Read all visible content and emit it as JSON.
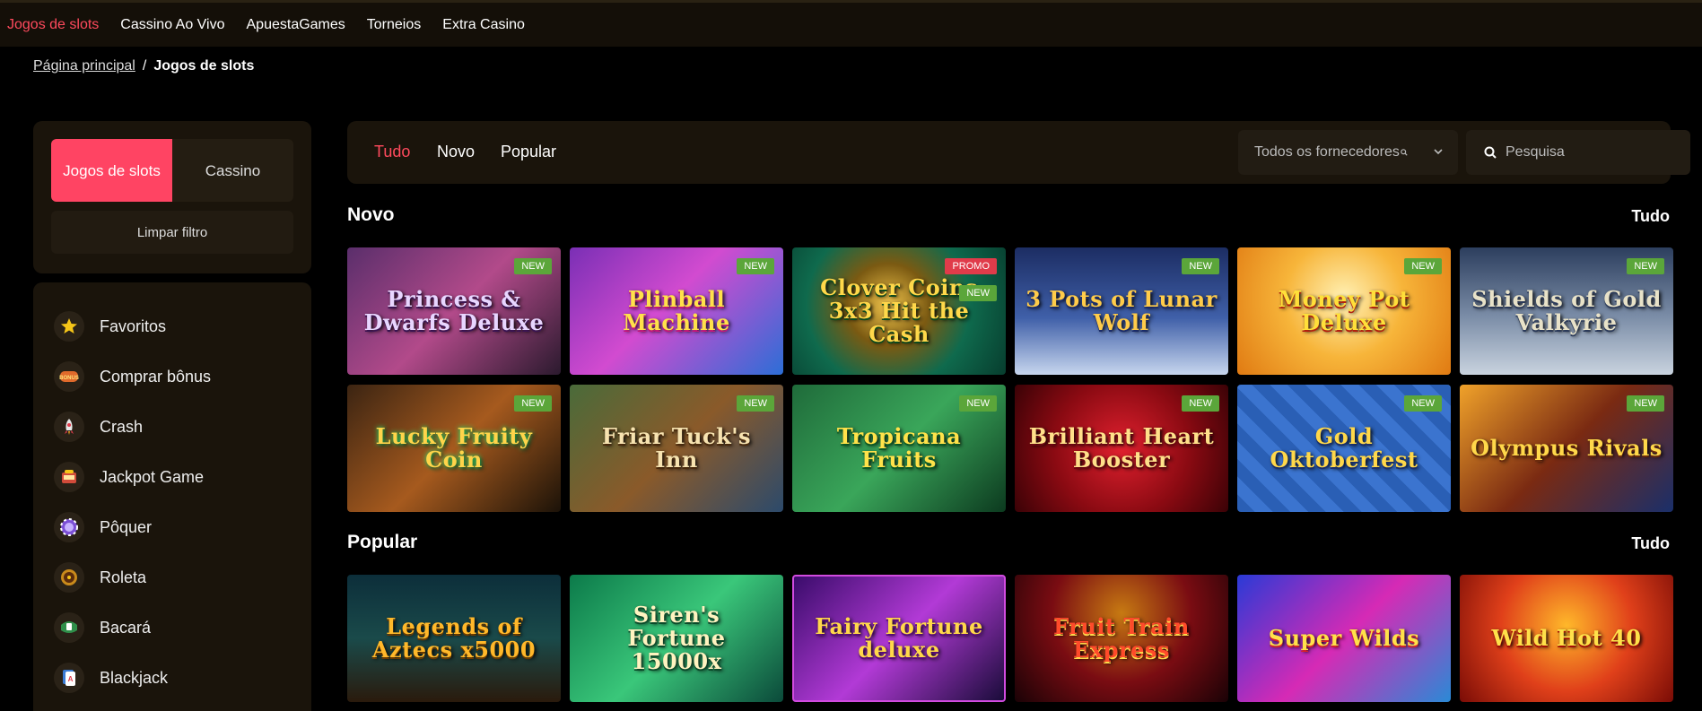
{
  "topnav": {
    "items": [
      "Jogos de slots",
      "Cassino Ao Vivo",
      "ApuestaGames",
      "Torneios",
      "Extra Casino"
    ]
  },
  "breadcrumb": {
    "home": "Página principal",
    "current": "Jogos de slots"
  },
  "sidebar": {
    "tabs": [
      "Jogos de slots",
      "Cassino"
    ],
    "clear_filter": "Limpar filtro",
    "categories": [
      {
        "label": "Favoritos",
        "icon": "star-icon"
      },
      {
        "label": "Comprar bônus",
        "icon": "bonus-icon"
      },
      {
        "label": "Crash",
        "icon": "rocket-icon"
      },
      {
        "label": "Jackpot Game",
        "icon": "jackpot-icon"
      },
      {
        "label": "Pôquer",
        "icon": "poker-chip-icon"
      },
      {
        "label": "Roleta",
        "icon": "roulette-icon"
      },
      {
        "label": "Bacará",
        "icon": "baccarat-icon"
      },
      {
        "label": "Blackjack",
        "icon": "blackjack-icon"
      }
    ]
  },
  "filters": {
    "tabs": [
      "Tudo",
      "Novo",
      "Popular"
    ],
    "provider_select": "Todos os fornecedores",
    "search_placeholder": "Pesquisa"
  },
  "sections": {
    "novo": {
      "title": "Novo",
      "all_label": "Tudo",
      "games": [
        {
          "title": "Princess & Dwarfs Deluxe",
          "badges": [
            "NEW"
          ]
        },
        {
          "title": "Plinball Machine",
          "badges": [
            "NEW"
          ]
        },
        {
          "title": "Clover Coins 3x3 Hit the Cash",
          "badges": [
            "PROMO",
            "NEW"
          ]
        },
        {
          "title": "3 Pots of Lunar Wolf",
          "badges": [
            "NEW"
          ]
        },
        {
          "title": "Money Pot Deluxe",
          "badges": [
            "NEW"
          ]
        },
        {
          "title": "Shields of Gold Valkyrie",
          "badges": [
            "NEW"
          ]
        },
        {
          "title": "Lucky Fruity Coin",
          "badges": [
            "NEW"
          ]
        },
        {
          "title": "Friar Tuck's Inn",
          "badges": [
            "NEW"
          ]
        },
        {
          "title": "Tropicana Fruits",
          "badges": [
            "NEW"
          ]
        },
        {
          "title": "Brilliant Heart Booster",
          "badges": [
            "NEW"
          ]
        },
        {
          "title": "Gold Oktoberfest",
          "badges": [
            "NEW"
          ]
        },
        {
          "title": "Olympus Rivals",
          "badges": [
            "NEW"
          ]
        }
      ]
    },
    "popular": {
      "title": "Popular",
      "all_label": "Tudo",
      "games": [
        {
          "title": "Legends of Aztecs x5000",
          "badges": []
        },
        {
          "title": "Siren's Fortune 15000x",
          "badges": []
        },
        {
          "title": "Fairy Fortune deluxe",
          "badges": []
        },
        {
          "title": "Fruit Train Express",
          "badges": []
        },
        {
          "title": "Super Wilds",
          "badges": []
        },
        {
          "title": "Wild Hot 40",
          "badges": []
        }
      ]
    }
  },
  "colors": {
    "accent": "#ff4463",
    "new_badge": "#5ba63a",
    "promo_badge": "#e03b4a",
    "panel": "#1a140b"
  }
}
